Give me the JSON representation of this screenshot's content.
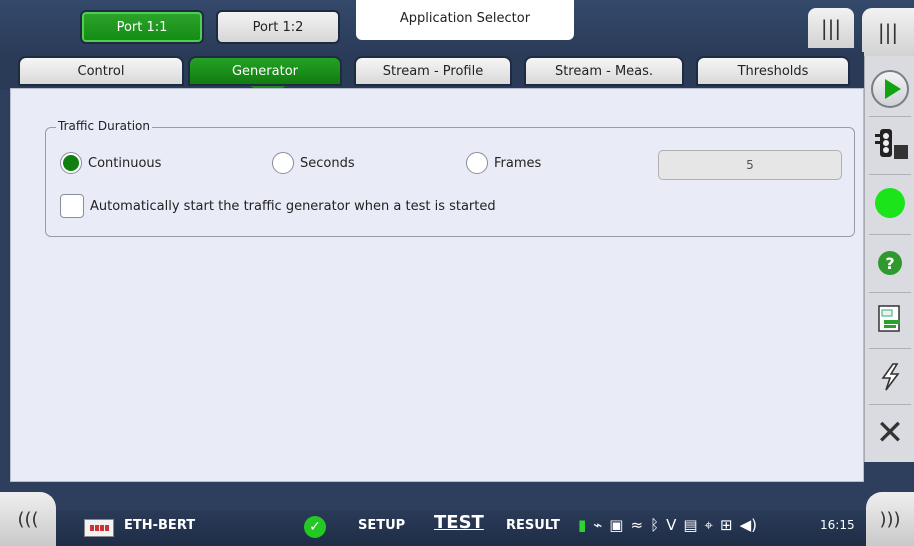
{
  "header": {
    "ports": [
      "Port 1:1",
      "Port 1:2"
    ],
    "app_selector": "Application Selector",
    "menu_icon": "menu-bars-icon"
  },
  "tabs": [
    "Control",
    "Generator",
    "Stream - Profile",
    "Stream - Meas.",
    "Thresholds"
  ],
  "active_tab": "Generator",
  "traffic": {
    "group_title": "Traffic Duration",
    "options": [
      "Continuous",
      "Seconds",
      "Frames"
    ],
    "selected": "Continuous",
    "value": "5",
    "auto_start_label": "Automatically start the traffic generator when a test is started",
    "auto_start_checked": false
  },
  "sidebar": {
    "icons": [
      "play-icon",
      "traffic-light-icon",
      "status-dot-icon",
      "help-icon",
      "report-icon",
      "lightning-icon",
      "close-icon"
    ]
  },
  "bottom": {
    "app_name": "ETH-BERT",
    "setup": "SETUP",
    "test": "TEST",
    "result": "RESULT",
    "time": "16:15"
  },
  "colors": {
    "accent_green": "#138a13",
    "panel_bg": "#e9ebf6",
    "header_bg": "#2a3b58"
  }
}
